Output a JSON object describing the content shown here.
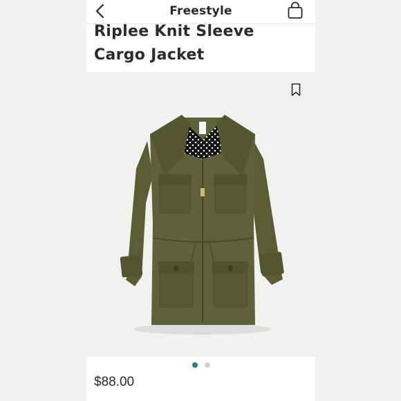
{
  "header": {
    "title": "Freestyle",
    "back_icon": "chevron-left-icon",
    "bag_icon": "shopping-bag-icon"
  },
  "product": {
    "title_line1": "Riplee Knit Sleeve",
    "title_line2": "Cargo Jacket",
    "price": "$88.00",
    "image_alt": "olive green cargo jacket with polka dot lined collar",
    "bookmark_icon": "bookmark-icon"
  },
  "carousel": {
    "count": 2,
    "active_index": 0
  },
  "colors": {
    "accent": "#1e8a87",
    "jacket": "#5a5a33",
    "text": "#2a2a2a"
  }
}
